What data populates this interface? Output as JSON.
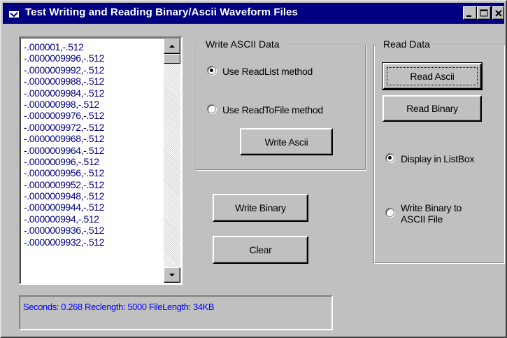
{
  "window": {
    "title": "Test Writing and Reading Binary/Ascii Waveform Files"
  },
  "listbox": {
    "items": [
      "-.000001,-.512",
      "-.0000009996,-.512",
      "-.0000009992,-.512",
      "-.0000009988,-.512",
      "-.0000009984,-.512",
      "-.000000998,-.512",
      "-.0000009976,-.512",
      "-.0000009972,-.512",
      "-.0000009968,-.512",
      "-.0000009964,-.512",
      "-.000000996,-.512",
      "-.0000009956,-.512",
      "-.0000009952,-.512",
      "-.0000009948,-.512",
      "-.0000009944,-.512",
      "-.000000994,-.512",
      "-.0000009936,-.512",
      "-.0000009932,-.512"
    ]
  },
  "write_ascii_group": {
    "label": "Write ASCII  Data",
    "radio_readlist": {
      "label": "Use ReadList method",
      "checked": true
    },
    "radio_readtofile": {
      "label": "Use ReadToFile method",
      "checked": false
    },
    "write_ascii_button": "Write Ascii"
  },
  "buttons": {
    "write_binary": "Write Binary",
    "clear": "Clear"
  },
  "read_data_group": {
    "label": "Read Data",
    "read_ascii_button": "Read Ascii",
    "read_binary_button": "Read Binary",
    "radio_display_listbox": {
      "label": "Display in ListBox",
      "checked": true
    },
    "radio_write_binary_ascii": {
      "label_line1": "Write Binary to",
      "label_line2": "ASCII File",
      "checked": false
    }
  },
  "status": {
    "text": "Seconds: 0.268 Reclength: 5000 FileLength: 34KB"
  }
}
